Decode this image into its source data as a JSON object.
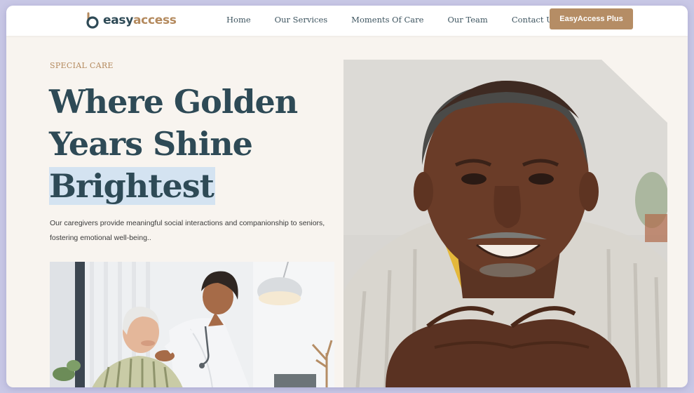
{
  "brand": {
    "easy": "easy",
    "access": "access",
    "accent": "#b48a5e",
    "primary": "#2e4a56"
  },
  "nav": {
    "items": [
      {
        "label": "Home"
      },
      {
        "label": "Our Services"
      },
      {
        "label": "Moments Of Care"
      },
      {
        "label": "Our Team"
      },
      {
        "label": "Contact Us"
      }
    ],
    "cta_label": "EasyAccess Plus"
  },
  "hero": {
    "eyebrow": "SPECIAL CARE",
    "headline": [
      "Where Golden",
      "Years Shine",
      "Brightest"
    ],
    "description": [
      "Our caregivers provide meaningful social interactions and companionship to seniors,",
      "fostering emotional well-being.."
    ],
    "highlight_color": "#d4e3f1"
  }
}
